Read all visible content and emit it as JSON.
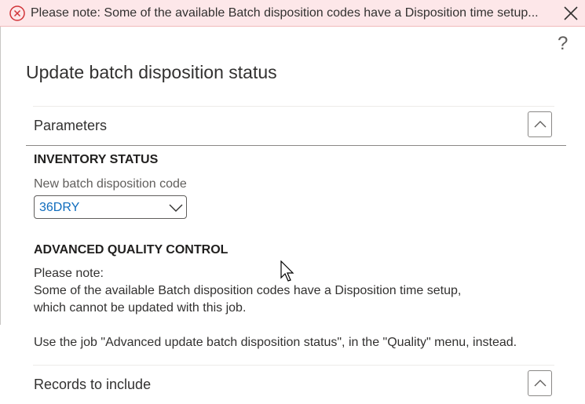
{
  "banner": {
    "message": "Please note: Some of the available Batch disposition codes have a Disposition time setup...",
    "icon": "error-circle-icon",
    "close_icon": "close-icon",
    "color": "#d13438"
  },
  "dialog": {
    "help_glyph": "?",
    "title": "Update batch disposition status"
  },
  "parameters": {
    "label": "Parameters",
    "inventory_status": {
      "heading": "INVENTORY STATUS",
      "field_label": "New batch disposition code",
      "field_value": "36DRY"
    },
    "advanced_quality_control": {
      "heading": "ADVANCED QUALITY CONTROL",
      "note_lines": [
        "Please note:",
        "Some of the available Batch disposition codes have a Disposition time setup,",
        "which cannot be updated with this job.",
        "Use the job \"Advanced update batch disposition status\", in the \"Quality\" menu, instead."
      ]
    }
  },
  "records_to_include": {
    "label": "Records to include"
  }
}
